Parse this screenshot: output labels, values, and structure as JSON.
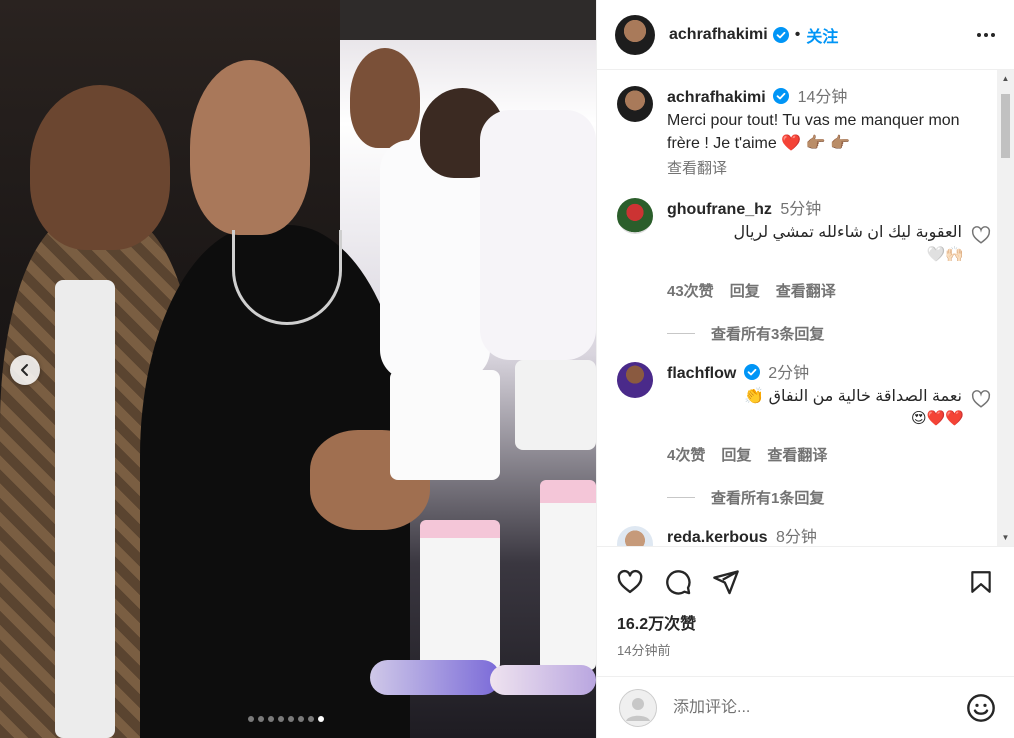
{
  "post": {
    "username": "achrafhakimi",
    "follow_label": "关注",
    "likes": "16.2万次赞",
    "posted_ago": "14分钟前",
    "carousel": {
      "count": 8,
      "active_index": 7
    }
  },
  "comments": [
    {
      "username": "achrafhakimi",
      "time": "14分钟",
      "verified": true,
      "text": "Merci pour tout! Tu vas me manquer mon frère ! Je t'aime ❤️ 👉🏽 👉🏽",
      "translate_label": "查看翻译"
    },
    {
      "username": "ghoufrane_hz",
      "time": "5分钟",
      "verified": false,
      "text": "العقوبة ليك ان شاءلله تمشي لريال",
      "emoji_line": "🤍🙌🏻",
      "likes": "43次赞",
      "reply_label": "回复",
      "translate_label": "查看翻译",
      "view_replies": "查看所有3条回复"
    },
    {
      "username": "flachflow",
      "time": "2分钟",
      "verified": true,
      "text": "نعمة الصداقة خالية من النفاق 👏",
      "emoji_line": "😍❤️❤️",
      "likes": "4次赞",
      "reply_label": "回复",
      "translate_label": "查看翻译",
      "view_replies": "查看所有1条回复"
    },
    {
      "username": "reda.kerbous",
      "time": "8分钟",
      "verified": false
    }
  ],
  "composer": {
    "placeholder": "添加评论..."
  },
  "icons": {
    "like": "heart-icon",
    "comment": "comment-icon",
    "share": "send-icon",
    "save": "bookmark-icon",
    "more": "more-icon",
    "emoji": "emoji-icon",
    "prev": "chevron-left-icon",
    "verified": "verified-badge-icon"
  },
  "colors": {
    "accent": "#0095f6",
    "secondary_text": "#737373",
    "border": "#efefef"
  }
}
